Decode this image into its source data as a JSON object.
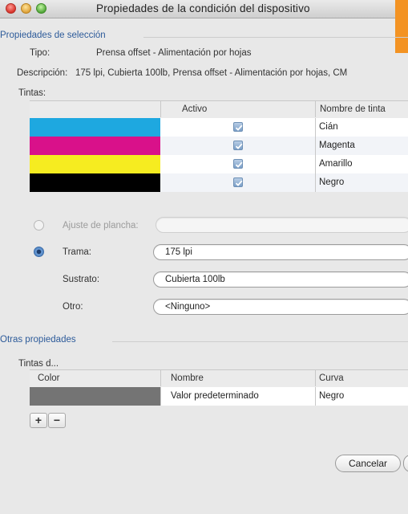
{
  "window": {
    "title": "Propiedades de la condición del dispositivo"
  },
  "selection": {
    "heading": "Propiedades de selección",
    "tipo_label": "Tipo:",
    "tipo_value": "Prensa offset - Alimentación por hojas",
    "desc_label": "Descripción:",
    "desc_value": "175 lpi, Cubierta 100lb, Prensa offset - Alimentación por hojas, CM",
    "tintas_label": "Tintas:"
  },
  "inks_table": {
    "col_activo": "Activo",
    "col_nombre": "Nombre de tinta",
    "rows": [
      {
        "color": "#1ea8e0",
        "active": true,
        "name": "Cián"
      },
      {
        "color": "#d9118a",
        "active": true,
        "name": "Magenta"
      },
      {
        "color": "#f6ec20",
        "active": true,
        "name": "Amarillo"
      },
      {
        "color": "#000000",
        "active": true,
        "name": "Negro"
      }
    ]
  },
  "options": {
    "ajuste_label": "Ajuste de plancha:",
    "ajuste_value": "",
    "trama_label": "Trama:",
    "trama_value": "175 lpi",
    "sustrato_label": "Sustrato:",
    "sustrato_value": "Cubierta 100lb",
    "otro_label": "Otro:",
    "otro_value": "<Ninguno>",
    "selected": "trama"
  },
  "other": {
    "heading": "Otras propiedades",
    "tintas_label": "Tintas d...",
    "col_color": "Color",
    "col_nombre": "Nombre",
    "col_curva": "Curva",
    "rows": [
      {
        "color": "#747474",
        "name": "Valor predeterminado",
        "curva": "Negro"
      }
    ]
  },
  "buttons": {
    "add": "+",
    "remove": "−",
    "cancel": "Cancelar"
  }
}
